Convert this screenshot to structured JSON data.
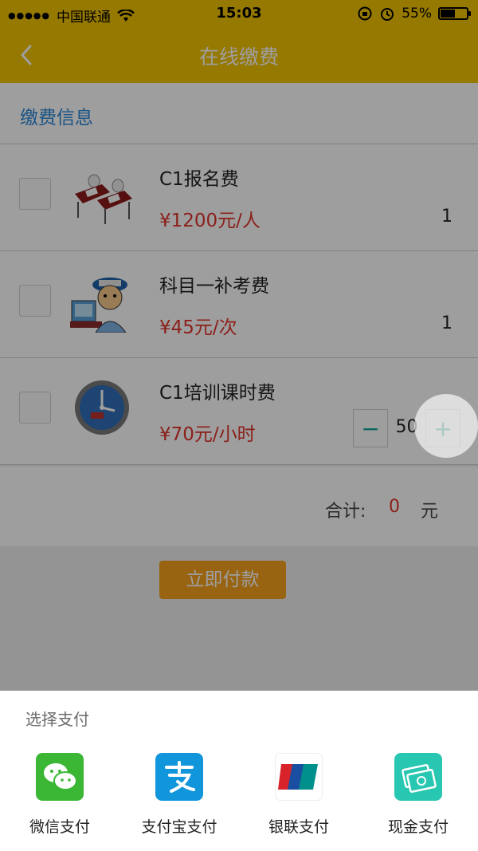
{
  "status_bar": {
    "carrier": "中国联通",
    "time": "15:03",
    "battery": "55%",
    "battery_level": 0.55
  },
  "nav": {
    "title": "在线缴费"
  },
  "section": {
    "title": "缴费信息"
  },
  "fees": [
    {
      "name": "C1报名费",
      "price": "¥1200元/人",
      "quantity": "1"
    },
    {
      "name": "科目一补考费",
      "price": "¥45元/次",
      "quantity": "1"
    },
    {
      "name": "C1培训课时费",
      "price": "¥70元/小时",
      "quantity": "50"
    }
  ],
  "stepper": {
    "minus": "−",
    "plus": "+"
  },
  "total": {
    "label": "合计:",
    "amount": "0",
    "unit": "元"
  },
  "pay_button": "立即付款",
  "payment_sheet": {
    "title": "选择支付",
    "options": [
      {
        "label": "微信支付",
        "icon": "wechat-pay-icon",
        "color": "#3bb635"
      },
      {
        "label": "支付宝支付",
        "icon": "alipay-icon",
        "color": "#1296db"
      },
      {
        "label": "银联支付",
        "icon": "unionpay-icon",
        "color": "#ffffff"
      },
      {
        "label": "现金支付",
        "icon": "cash-icon",
        "color": "#27c7b1"
      }
    ]
  }
}
